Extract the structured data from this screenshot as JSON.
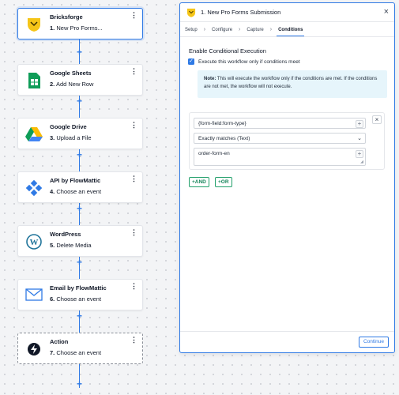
{
  "workflow": {
    "steps": [
      {
        "app": "Bricksforge",
        "number": "1.",
        "action": "New Pro Forms...",
        "icon": "bricksforge-icon"
      },
      {
        "app": "Google Sheets",
        "number": "2.",
        "action": "Add New Row",
        "icon": "google-sheets-icon"
      },
      {
        "app": "Google Drive",
        "number": "3.",
        "action": "Upload a File",
        "icon": "google-drive-icon"
      },
      {
        "app": "API by FlowMattic",
        "number": "4.",
        "action": "Choose an event",
        "icon": "api-icon"
      },
      {
        "app": "WordPress",
        "number": "5.",
        "action": "Delete Media",
        "icon": "wordpress-icon"
      },
      {
        "app": "Email by FlowMattic",
        "number": "6.",
        "action": "Choose an event",
        "icon": "email-icon"
      },
      {
        "app": "Action",
        "number": "7.",
        "action": "Choose an event",
        "icon": "bolt-icon"
      }
    ],
    "add_glyph": "+",
    "menu_glyph": "⋮"
  },
  "panel": {
    "title": "1. New Pro Forms Submission",
    "close_glyph": "×",
    "tabs": [
      "Setup",
      "Configure",
      "Capture",
      "Conditions"
    ],
    "tab_separator": "›",
    "section_title": "Enable Conditional Execution",
    "checkbox_label": "Execute this workflow only if conditions meet",
    "note_label": "Note:",
    "note_text": " This will execute the workflow only if the conditions are met. If the conditions are not met, the workflow will not execute.",
    "condition": {
      "field": "{form-field:form-type}",
      "operator": "Exactly matches (Text)",
      "value": "order-form-en"
    },
    "and_button": "AND",
    "or_button": "OR",
    "continue_button": "Continue"
  },
  "colors": {
    "accent": "#2f7ae5",
    "green": "#22a06b",
    "note_bg": "#e6f5fb"
  }
}
